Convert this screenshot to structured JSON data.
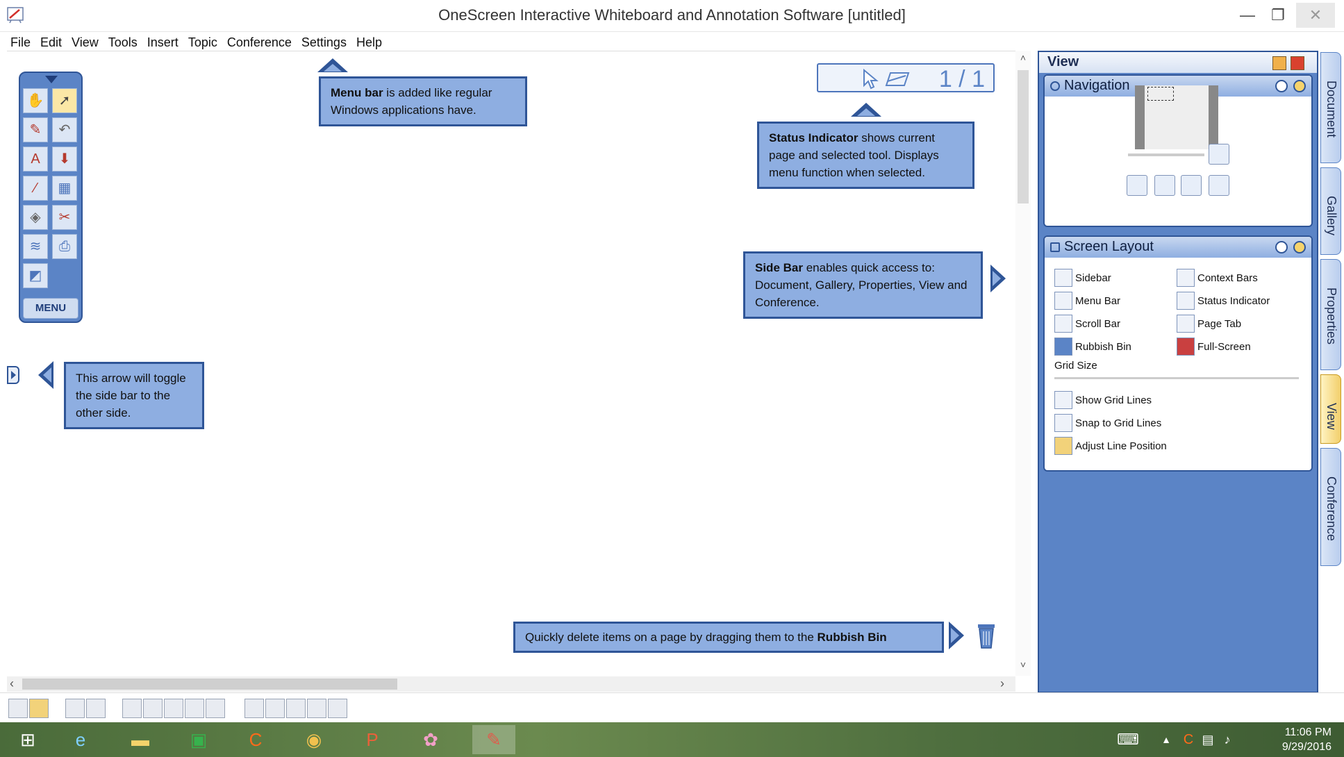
{
  "window": {
    "title": "OneScreen Interactive Whiteboard and Annotation Software [untitled]",
    "minimize": "—",
    "restore": "❐",
    "close": "✕"
  },
  "menubar": {
    "items": [
      "File",
      "Edit",
      "View",
      "Tools",
      "Insert",
      "Topic",
      "Conference",
      "Settings",
      "Help"
    ]
  },
  "toolbox": {
    "menu_label": "MENU",
    "icons": [
      "hand-icon",
      "pointer-icon",
      "pen-icon",
      "undo-icon",
      "text-pen-icon",
      "insert-icon",
      "highlighter-icon",
      "gallery-icon",
      "eraser-icon",
      "fill-icon",
      "layers-icon",
      "print-icon",
      "shapes-icon"
    ]
  },
  "status_indicator": {
    "page": "1 / 1"
  },
  "callouts": {
    "menu_bar": {
      "bold": "Menu bar",
      "text": " is added like regular Windows applications have."
    },
    "status": {
      "bold": "Status Indicator",
      "text": " shows current page and selected tool. Displays menu function when selected."
    },
    "side_bar": {
      "bold": "Side Bar",
      "text": " enables quick access to: Document, Gallery, Properties, View and Conference."
    },
    "toggle": {
      "text": "This arrow will toggle the side bar to the other side."
    },
    "rubbish": {
      "text": "Quickly delete items on a page by dragging them to the ",
      "bold": "Rubbish Bin"
    }
  },
  "panel": {
    "title": "View",
    "navigation": {
      "title": "Navigation"
    },
    "screen_layout": {
      "title": "Screen Layout",
      "options_left": [
        "Sidebar",
        "Menu Bar",
        "Scroll Bar",
        "Rubbish Bin"
      ],
      "options_right": [
        "Context Bars",
        "Status Indicator",
        "Page Tab",
        "Full-Screen"
      ],
      "grid_size_label": "Grid Size",
      "grid_options": [
        "Show Grid Lines",
        "Snap to Grid Lines",
        "Adjust Line Position"
      ]
    }
  },
  "side_tabs": [
    "Document",
    "Gallery",
    "Properties",
    "View",
    "Conference"
  ],
  "taskbar": {
    "time": "11:06 PM",
    "date": "9/29/2016"
  },
  "colors": {
    "accent": "#2f5597",
    "callout_fill": "#8eaee1",
    "panel_blue": "#5b84c6"
  }
}
